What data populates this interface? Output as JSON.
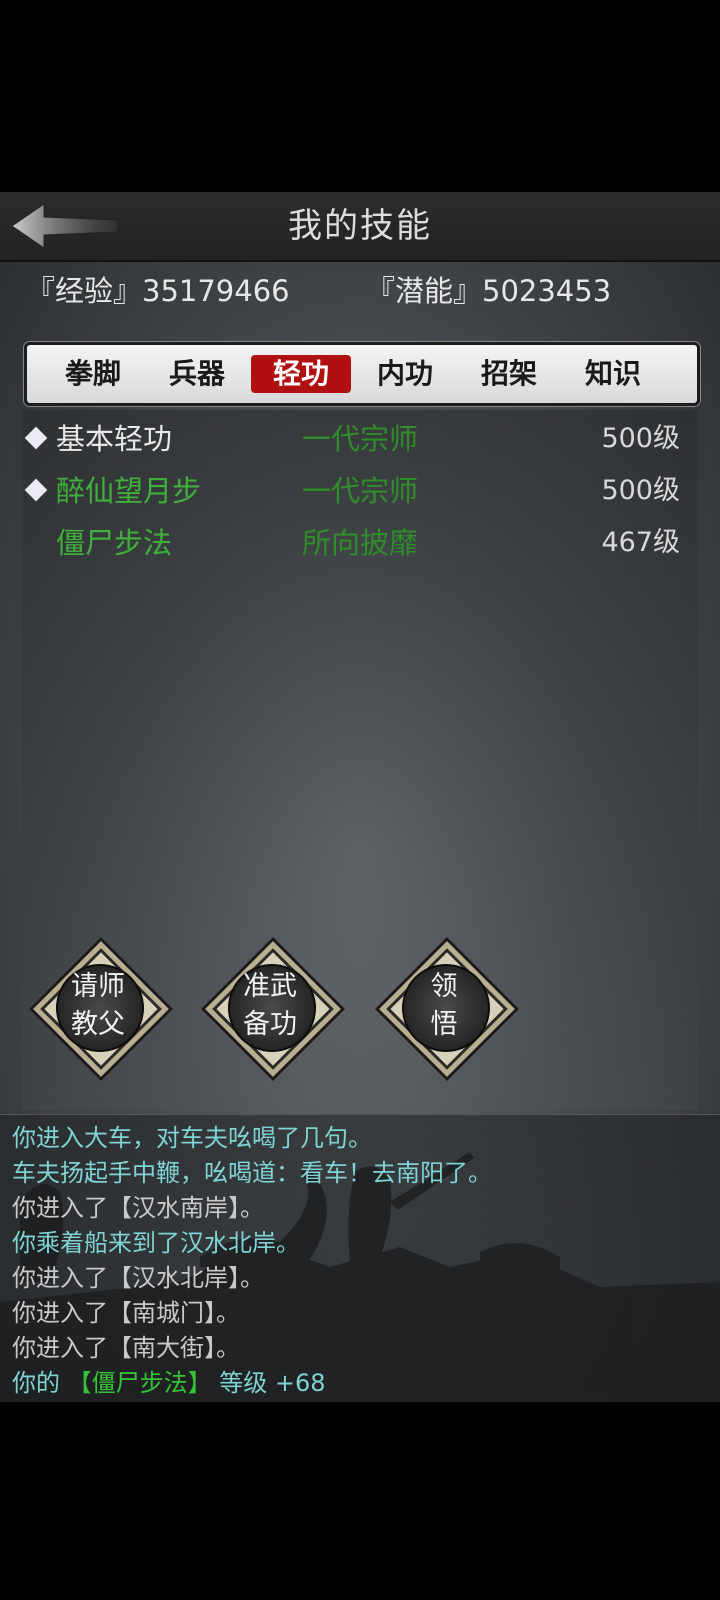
{
  "header": {
    "title": "我的技能",
    "back_icon": "back-arrow-icon"
  },
  "stats": {
    "exp": "『经验』35179466",
    "potential": "『潜能』5023453"
  },
  "tabs": [
    {
      "label": "拳脚",
      "active": false
    },
    {
      "label": "兵器",
      "active": false
    },
    {
      "label": "轻功",
      "active": true
    },
    {
      "label": "内功",
      "active": false
    },
    {
      "label": "招架",
      "active": false
    },
    {
      "label": "知识",
      "active": false
    }
  ],
  "skills": [
    {
      "name": "基本轻功",
      "rank": "一代宗师",
      "level": "500级",
      "marked": true,
      "name_color": "#e8e8e8"
    },
    {
      "name": "醉仙望月步",
      "rank": "一代宗师",
      "level": "500级",
      "marked": true,
      "name_color": "#3fb03a"
    },
    {
      "name": "僵尸步法",
      "rank": "所向披靡",
      "level": "467级",
      "marked": false,
      "name_color": "#3fb03a"
    }
  ],
  "actions": [
    {
      "line1": "请师",
      "line2": "教父"
    },
    {
      "line1": "准武",
      "line2": "备功"
    },
    {
      "line1": "领",
      "line2": "悟"
    }
  ],
  "log": [
    {
      "text": "你进入大车，对车夫吆喝了几句。",
      "color": "cyan"
    },
    {
      "text": "车夫扬起手中鞭，吆喝道：看车！去南阳了。",
      "color": "cyan"
    },
    {
      "text": "你进入了【汉水南岸】。",
      "color": "grey"
    },
    {
      "text": "你乘着船来到了汉水北岸。",
      "color": "cyan"
    },
    {
      "text": "你进入了【汉水北岸】。",
      "color": "grey"
    },
    {
      "text": "你进入了【南城门】。",
      "color": "grey"
    },
    {
      "text": "你进入了【南大街】。",
      "color": "grey"
    }
  ],
  "log_last": {
    "prefix": "你的",
    "skill": "【僵尸步法】",
    "suffix": "等级 +68"
  }
}
